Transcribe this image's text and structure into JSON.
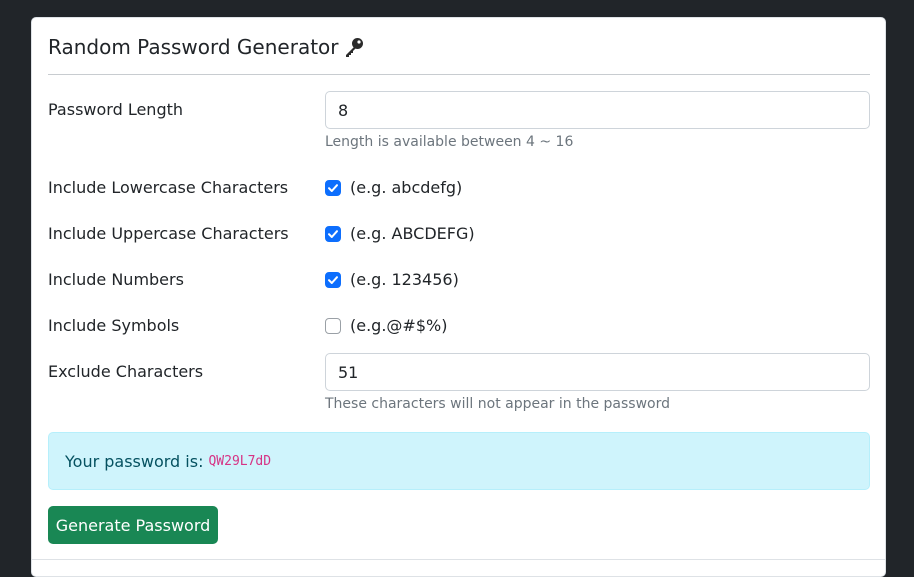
{
  "header": {
    "title": "Random Password Generator",
    "icon": "key-icon"
  },
  "form": {
    "length_label": "Password Length",
    "length_value": "8",
    "length_help": "Length is available between 4 ~ 16",
    "options": [
      {
        "label": "Include Lowercase Characters",
        "hint": "(e.g. abcdefg)",
        "checked": true
      },
      {
        "label": "Include Uppercase Characters",
        "hint": "(e.g. ABCDEFG)",
        "checked": true
      },
      {
        "label": "Include Numbers",
        "hint": "(e.g. 123456)",
        "checked": true
      },
      {
        "label": "Include Symbols",
        "hint": "(e.g.@#$%)",
        "checked": false
      }
    ],
    "exclude_label": "Exclude Characters",
    "exclude_value": "51",
    "exclude_help": "These characters will not appear in the password"
  },
  "result": {
    "label": "Your password is:",
    "password": "QW29L7dD"
  },
  "actions": {
    "generate_label": "Generate Password"
  },
  "colors": {
    "page_background": "#212529",
    "checkbox_checked": "#0d6efd",
    "alert_background": "#cff4fc",
    "alert_text": "#055160",
    "password_text": "#d63384",
    "button_background": "#198754"
  }
}
